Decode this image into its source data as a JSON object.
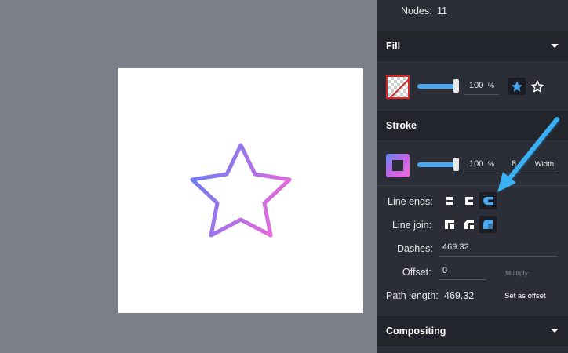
{
  "nodes": {
    "label": "Nodes:",
    "value": "11"
  },
  "fill": {
    "title": "Fill",
    "opacity": "100",
    "opacity_level": 1.0,
    "unit": "%",
    "swatch_icon": "no-fill-checker-icon",
    "mode_icons": [
      "star-filled-icon",
      "star-outline-icon"
    ]
  },
  "stroke": {
    "title": "Stroke",
    "opacity": "100",
    "opacity_level": 1.0,
    "unit": "%",
    "width": "8",
    "width_label": "Width",
    "line_ends_label": "Line ends:",
    "line_join_label": "Line join:",
    "dashes_label": "Dashes:",
    "dashes_value": "469.32",
    "offset_label": "Offset:",
    "offset_value": "0",
    "multiply_label": "Multiply...",
    "path_length_label": "Path length:",
    "path_length_value": "469.32",
    "set_offset_label": "Set as offset"
  },
  "compositing": {
    "title": "Compositing"
  },
  "colors": {
    "gradient_start": "#5f86ee",
    "gradient_end": "#ef6bd6",
    "accent": "#4aa8f0",
    "arrow": "#3bb0f2"
  }
}
